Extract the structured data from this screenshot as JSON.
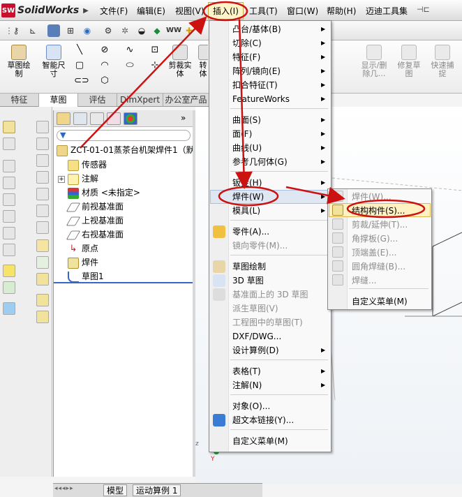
{
  "app": {
    "name": "SolidWorks",
    "logo_icon": "solidworks-logo-icon"
  },
  "menu": {
    "items": [
      "文件(F)",
      "编辑(E)",
      "视图(V)",
      "插入(I)",
      "工具(T)",
      "窗口(W)",
      "帮助(H)",
      "迈迪工具集"
    ],
    "active": "插入(I)"
  },
  "command_manager": {
    "sketch_button": "草图绘\n制",
    "smart_dim_button": "智能尺\n寸",
    "trim_button": "剪裁实\n体",
    "convert_button": "转\n体",
    "display_delete": "显示/删\n除几…",
    "repair_sketch": "修复草\n图",
    "quick_snap": "快速捕\n捉"
  },
  "tabs": [
    "特征",
    "草图",
    "评估",
    "DimXpert",
    "办公室产品"
  ],
  "selected_tab": "草图",
  "feature_tree": {
    "root": "ZCT-01-01蒸茶台机架焊件1（默",
    "items": [
      "传感器",
      "注解",
      "材质 <未指定>",
      "前视基准面",
      "上视基准面",
      "右视基准面",
      "原点",
      "焊件",
      "草图1"
    ]
  },
  "insert_menu": {
    "items": [
      {
        "label": "凸台/基体(B)",
        "submenu": true,
        "disabled": false
      },
      {
        "label": "切除(C)",
        "submenu": true,
        "disabled": false
      },
      {
        "label": "特征(F)",
        "submenu": true,
        "disabled": false
      },
      {
        "label": "阵列/镜向(E)",
        "submenu": true,
        "disabled": false
      },
      {
        "label": "扣合特征(T)",
        "submenu": true,
        "disabled": false
      },
      {
        "label": "FeatureWorks",
        "submenu": true,
        "disabled": false
      },
      {
        "label": "曲面(S)",
        "submenu": true,
        "disabled": false
      },
      {
        "label": "面(F)",
        "submenu": true,
        "disabled": false
      },
      {
        "label": "曲线(U)",
        "submenu": true,
        "disabled": false
      },
      {
        "label": "参考几何体(G)",
        "submenu": true,
        "disabled": false
      },
      {
        "label": "钣金(H)",
        "submenu": true,
        "disabled": false
      },
      {
        "label": "焊件(W)",
        "submenu": true,
        "disabled": false
      },
      {
        "label": "模具(L)",
        "submenu": true,
        "disabled": false
      },
      {
        "label": "零件(A)...",
        "submenu": false,
        "disabled": false
      },
      {
        "label": "镜向零件(M)...",
        "submenu": false,
        "disabled": true
      },
      {
        "label": "草图绘制",
        "submenu": false,
        "disabled": false
      },
      {
        "label": "3D 草图",
        "submenu": false,
        "disabled": false
      },
      {
        "label": "基准面上的 3D 草图",
        "submenu": false,
        "disabled": true
      },
      {
        "label": "派生草图(V)",
        "submenu": false,
        "disabled": true
      },
      {
        "label": "工程图中的草图(T)",
        "submenu": false,
        "disabled": true
      },
      {
        "label": "DXF/DWG...",
        "submenu": false,
        "disabled": false
      },
      {
        "label": "设计算例(D)",
        "submenu": true,
        "disabled": false
      },
      {
        "label": "表格(T)",
        "submenu": true,
        "disabled": false
      },
      {
        "label": "注解(N)",
        "submenu": true,
        "disabled": false
      },
      {
        "label": "对象(O)...",
        "submenu": false,
        "disabled": false
      },
      {
        "label": "超文本链接(Y)...",
        "submenu": false,
        "disabled": false
      },
      {
        "label": "自定义菜单(M)",
        "submenu": false,
        "disabled": false
      }
    ]
  },
  "weldment_submenu": {
    "items": [
      {
        "label": "焊件(W)...",
        "disabled": true
      },
      {
        "label": "结构构件(S)...",
        "disabled": false
      },
      {
        "label": "剪裁/延伸(T)...",
        "disabled": true
      },
      {
        "label": "角撑板(G)...",
        "disabled": true
      },
      {
        "label": "顶端盖(E)...",
        "disabled": true
      },
      {
        "label": "圆角焊缝(B)...",
        "disabled": true
      },
      {
        "label": "焊缝...",
        "disabled": true
      },
      {
        "label": "自定义菜单(M)",
        "disabled": false
      }
    ]
  },
  "bottom_tabs": [
    "模型",
    "运动算例 1"
  ],
  "axis": {
    "z": "z",
    "y": "Y"
  },
  "colors": {
    "annotation": "#cc1111",
    "highlight": "#fff1c2"
  }
}
